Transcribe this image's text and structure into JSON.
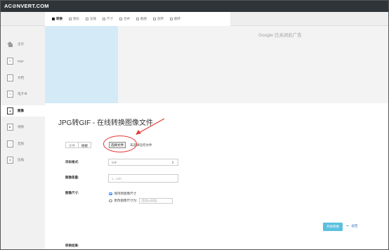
{
  "header": {
    "logo": "AC⊘NVERT.COM"
  },
  "tabs": [
    {
      "label": "转换",
      "active": true
    },
    {
      "label": "图标",
      "active": false
    },
    {
      "label": "压缩",
      "active": false
    },
    {
      "label": "尺寸",
      "active": false
    },
    {
      "label": "合并",
      "active": false
    },
    {
      "label": "截图",
      "active": false
    },
    {
      "label": "旋转",
      "active": false
    },
    {
      "label": "翻转",
      "active": false
    }
  ],
  "sidebar": {
    "items": [
      {
        "label": "主页",
        "icon": "home-icon",
        "active": false
      },
      {
        "label": "PDF",
        "icon": "pdf-file-icon",
        "active": false
      },
      {
        "label": "文档",
        "icon": "document-file-icon",
        "active": false
      },
      {
        "label": "电子书",
        "icon": "ebook-file-icon",
        "active": false
      },
      {
        "label": "图像",
        "icon": "image-file-icon",
        "active": true
      },
      {
        "label": "视频",
        "icon": "video-file-icon",
        "active": false
      },
      {
        "label": "音频",
        "icon": "audio-file-icon",
        "active": false
      },
      {
        "label": "压缩",
        "icon": "archive-file-icon",
        "active": false
      }
    ]
  },
  "ad": {
    "text": "Google 已关闭此广告"
  },
  "main": {
    "title": "JPG转GIF - 在线转换图像文件",
    "mode": {
      "options": [
        "文件",
        "链接"
      ],
      "selected": "链接"
    },
    "file_button": "选择文件",
    "file_status": "未选择任何文件",
    "target_format": {
      "label": "目标格式:",
      "value": "GIF"
    },
    "quality": {
      "label": "图像质量:",
      "placeholder": "1...100"
    },
    "image_size": {
      "label": "图像尺寸:",
      "option_keep": "保持原图像尺寸",
      "option_change": "更改图像尺寸为:",
      "size_placeholder": "[宽度]x[高度]"
    },
    "start_button": "开始转换",
    "back_link": "返回",
    "bottom_label": "转换结果:"
  },
  "colors": {
    "topbar": "#2e3437",
    "accent_button": "#5bc0de",
    "annotation_red": "#e53935",
    "ad_left": "#d4eaf7"
  }
}
